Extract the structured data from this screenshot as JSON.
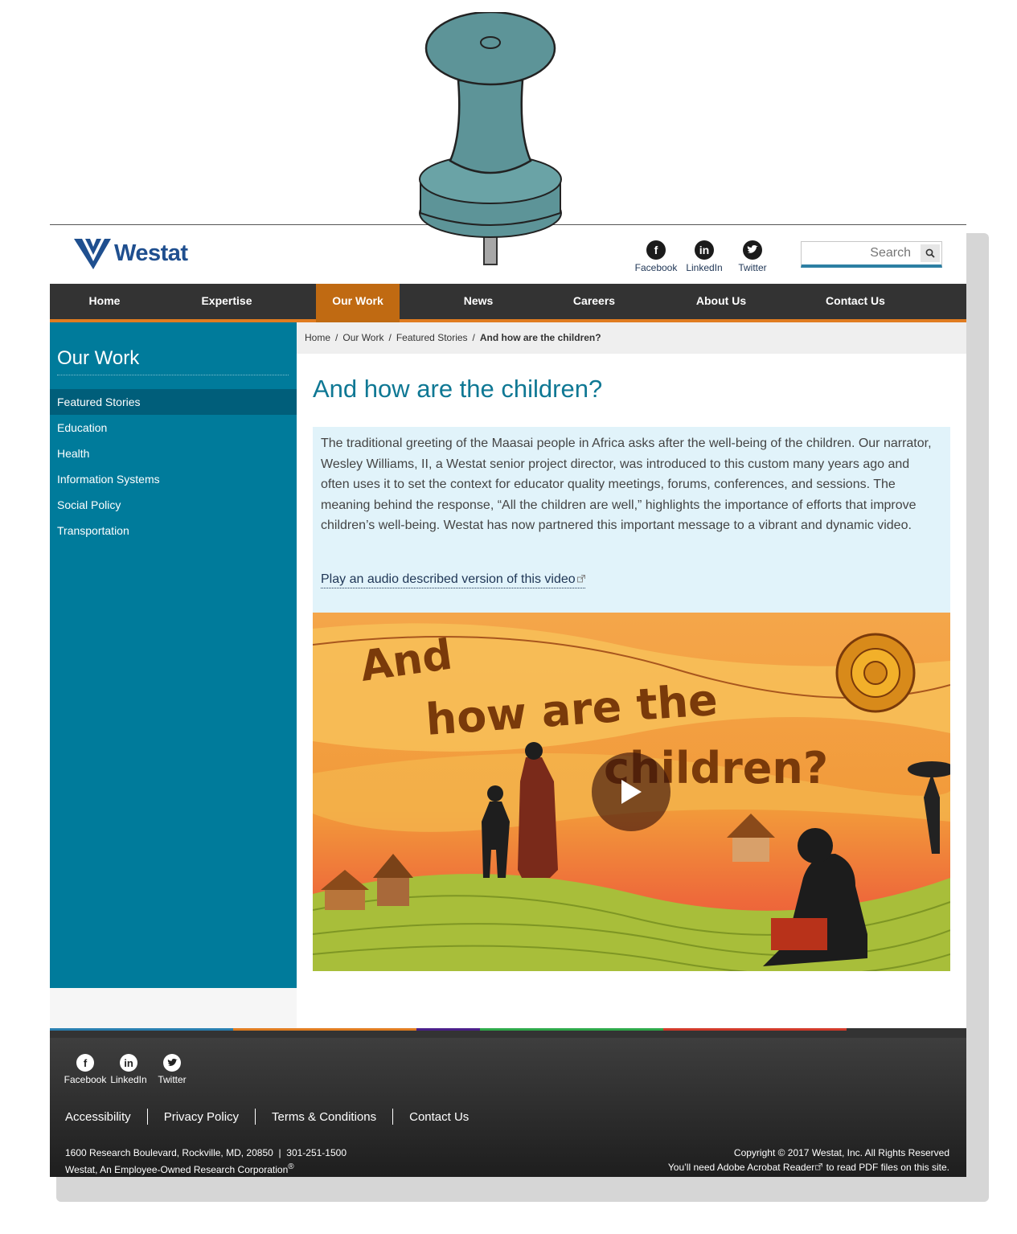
{
  "colors": {
    "teal": "#007b9b",
    "nav_bg": "#333333",
    "nav_active": "#c06a12",
    "accent_orange": "#e07c20",
    "title_blue": "#0f7894",
    "intro_bg": "#e1f3fa",
    "logo_blue": "#1f4f8f"
  },
  "header": {
    "logo_text": "Westat",
    "social": [
      {
        "label": "Facebook",
        "icon": "facebook-icon",
        "glyph": "f"
      },
      {
        "label": "LinkedIn",
        "icon": "linkedin-icon",
        "glyph": "in"
      },
      {
        "label": "Twitter",
        "icon": "twitter-icon",
        "glyph": "t"
      }
    ],
    "search": {
      "placeholder": "Search"
    }
  },
  "nav": {
    "items": [
      "Home",
      "Expertise",
      "Our Work",
      "News",
      "Careers",
      "About Us",
      "Contact Us"
    ],
    "active": "Our Work"
  },
  "sidebar": {
    "title": "Our Work",
    "items": [
      "Featured Stories",
      "Education",
      "Health",
      "Information Systems",
      "Social Policy",
      "Transportation"
    ],
    "active": "Featured Stories"
  },
  "breadcrumb": [
    "Home",
    "Our Work",
    "Featured Stories",
    "And how are the children?"
  ],
  "main": {
    "title": "And how are the children?",
    "intro": "The traditional greeting of the Maasai people in Africa asks after the well-being of the children. Our narrator, Wesley Williams, II, a Westat senior project director, was introduced to this custom many years ago and often uses it to set the context for educator quality meetings, forums, conferences, and sessions. The meaning behind the response, “All the children are well,” highlights the importance of efforts that improve children’s well-being. Westat has now partnered this important message to a vibrant and dynamic video.",
    "audio_link": "Play an audio described version of this video",
    "video_title_lines": [
      "And",
      "how are the",
      "children?"
    ]
  },
  "footer": {
    "social": [
      {
        "label": "Facebook",
        "glyph": "f"
      },
      {
        "label": "LinkedIn",
        "glyph": "in"
      },
      {
        "label": "Twitter",
        "glyph": "t"
      }
    ],
    "links": [
      "Accessibility",
      "Privacy Policy",
      "Terms & Conditions",
      "Contact Us"
    ],
    "address": "1600 Research Boulevard, Rockville, MD, 20850",
    "phone": "301-251-1500",
    "corp": "Westat, An Employee-Owned Research Corporation",
    "copyright": "Copyright © 2017 Westat, Inc. All Rights Reserved",
    "acrobat_prefix": "You’ll need ",
    "acrobat_link": "Adobe Acrobat Reader",
    "acrobat_suffix": " to read PDF files on this site.",
    "stripe_colors": [
      "#2a7fb0",
      "#e07c20",
      "#4a1f8a",
      "#2ea84a",
      "#d13a2a"
    ]
  }
}
